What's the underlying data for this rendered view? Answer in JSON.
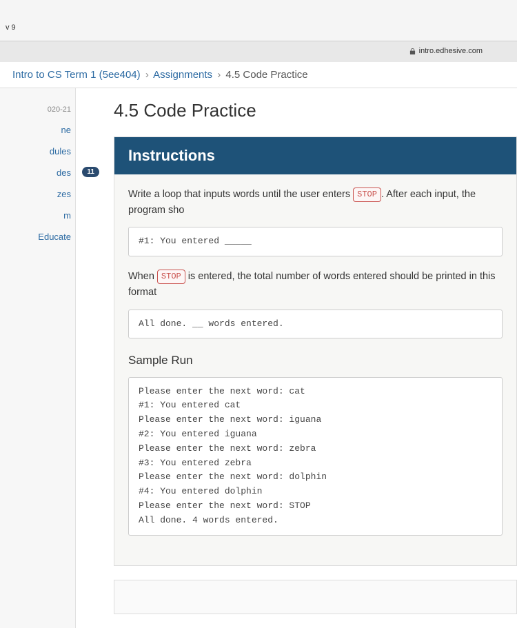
{
  "browser": {
    "tab_fragment": "v 9",
    "url": "intro.edhesive.com"
  },
  "breadcrumb": {
    "course": "Intro to CS Term 1 (5ee404)",
    "section": "Assignments",
    "current": "4.5 Code Practice"
  },
  "sidebar": {
    "term": "020-21",
    "items": [
      {
        "label": "ne"
      },
      {
        "label": "dules"
      },
      {
        "label": "des",
        "badge": "11"
      },
      {
        "label": "zes"
      },
      {
        "label": "m"
      },
      {
        "label": "Educate"
      }
    ]
  },
  "page": {
    "title": "4.5 Code Practice",
    "panel_header": "Instructions",
    "intro_a": "Write a loop that inputs words until the user enters ",
    "intro_stop": "STOP",
    "intro_b": ". After each input, the program sho",
    "code1": "#1: You entered _____",
    "mid_a": "When ",
    "mid_stop": "STOP",
    "mid_b": " is entered, the total number of words entered should be printed in this format",
    "code2": "All done. __ words entered.",
    "sample_heading": "Sample Run",
    "sample_output": "Please enter the next word: cat\n#1: You entered cat\nPlease enter the next word: iguana\n#2: You entered iguana\nPlease enter the next word: zebra\n#3: You entered zebra\nPlease enter the next word: dolphin\n#4: You entered dolphin\nPlease enter the next word: STOP\nAll done. 4 words entered."
  }
}
